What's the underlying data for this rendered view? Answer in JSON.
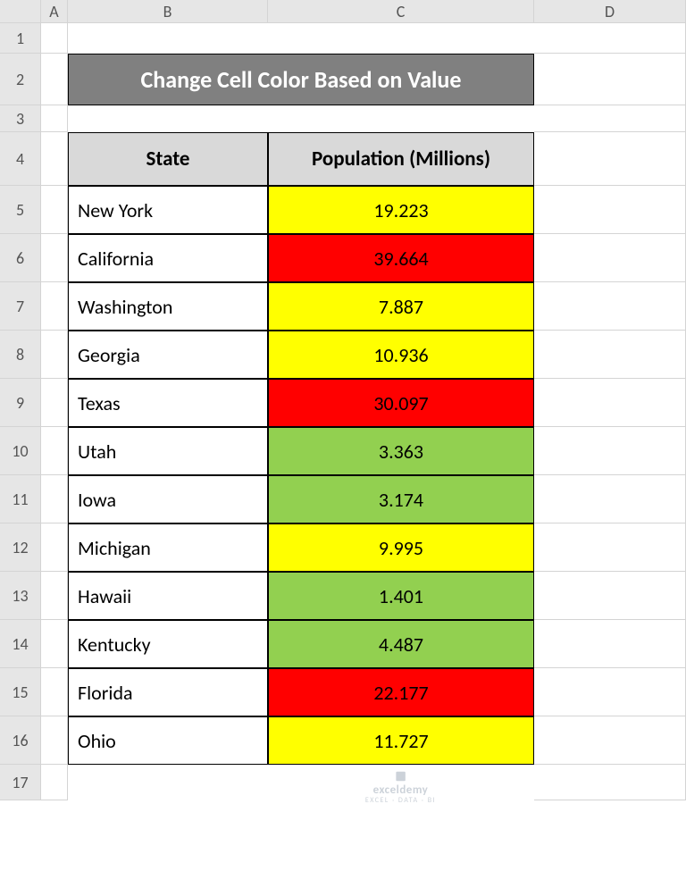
{
  "columns": [
    "A",
    "B",
    "C",
    "D"
  ],
  "rows": [
    "1",
    "2",
    "3",
    "4",
    "5",
    "6",
    "7",
    "8",
    "9",
    "10",
    "11",
    "12",
    "13",
    "14",
    "15",
    "16",
    "17"
  ],
  "title": "Change Cell Color Based on Value",
  "headers": {
    "state": "State",
    "population": "Population (Millions)"
  },
  "data": [
    {
      "state": "New York",
      "population": "19.223",
      "fill": "yellow"
    },
    {
      "state": "California",
      "population": "39.664",
      "fill": "red"
    },
    {
      "state": "Washington",
      "population": "7.887",
      "fill": "yellow"
    },
    {
      "state": "Georgia",
      "population": "10.936",
      "fill": "yellow"
    },
    {
      "state": "Texas",
      "population": "30.097",
      "fill": "red"
    },
    {
      "state": "Utah",
      "population": "3.363",
      "fill": "green"
    },
    {
      "state": "Iowa",
      "population": "3.174",
      "fill": "green"
    },
    {
      "state": "Michigan",
      "population": "9.995",
      "fill": "yellow"
    },
    {
      "state": "Hawaii",
      "population": "1.401",
      "fill": "green"
    },
    {
      "state": "Kentucky",
      "population": "4.487",
      "fill": "green"
    },
    {
      "state": "Florida",
      "population": "22.177",
      "fill": "red"
    },
    {
      "state": "Ohio",
      "population": "11.727",
      "fill": "yellow"
    }
  ],
  "watermark": {
    "brand": "exceldemy",
    "tagline": "EXCEL · DATA · BI"
  },
  "row_heights": {
    "blank": 34,
    "title": 58,
    "gap": 30,
    "header": 60,
    "data": 54,
    "last": 40
  }
}
